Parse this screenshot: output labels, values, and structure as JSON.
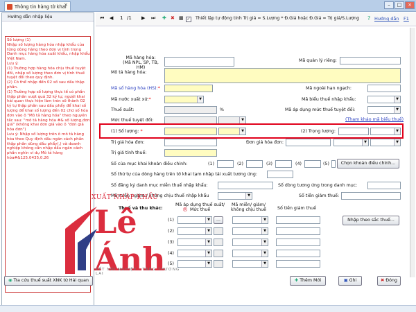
{
  "window": {
    "tab_title": "Thông tin hàng tờ khai",
    "close": "×"
  },
  "left_panel": {
    "header": "Hướng dẫn nhập liệu",
    "text": "Số lượng (1)\nNhập số lượng hàng hóa nhập khẩu của từng dòng hàng theo đơn vị tính trong Danh mục hàng hóa xuất khẩu, nhập khẩu Việt Nam.\nLưu ý:\n(1) Trường hợp hàng hóa chịu thuế tuyệt đối, nhập số lượng theo đơn vị tính thuế tuyệt đối theo quy định.\n(2) Có thể nhập đến 02 số sau dấu thập phân.\n(1) Trường hợp số lượng thực tế có phần thập phân vượt quá 32 ký tự, người khai hải quan thực hiện làm tròn số thành 02 ký tự thập phân sau dấu phẩy để khai số lượng để khai số lượng đến 02 chữ số hóa đơn vào ô \"Mô tả hàng hóa\" theo nguyên tắc sau: \"mô tả hàng hóa #& số lượng,đơn giá\" (không khai đơn giá vào ô \"đơn giá hóa đơn\")\nLưu ý: Nhập số lượng trên ô mô tả hàng hóa theo Quy định dấu ngăn cách phần thập phân dùng dấu phẩy(,) và doanh nghiệp không cần nhập dấu ngăn cách phần nghìn ví dụ Mô tả hàng hóa#&125.0435,0.26"
  },
  "toolbar": {
    "page_current": "1",
    "page_sep": "/1",
    "auto_calc_label": "Thiết lập tự động tính Trị giá = S.Lượng * Đ.Giá hoặc Đ.Giá = Trị giá/S.Lượng",
    "help_label": "Hướng dẫn",
    "help_key": "F1"
  },
  "form": {
    "ma_hang_hoa": "Mã hàng hóa:\n(Mã NPL, SP, TB, HM)",
    "ma_quan_ly_rieng": "Mã quản lý riêng:",
    "mo_ta_hang_hoa": "Mô tả hàng hóa:",
    "ma_so_hang_hoa": "Mã số hàng hóa (HS):",
    "ma_ngoai_han_ngach": "Mã ngoài hạn ngạch:",
    "ma_nuoc_xuat_xu": "Mã nước xuất xứ:",
    "ma_bieu_thue_nk": "Mã biểu thuế nhập khẩu:",
    "thue_suat": "Thuế suất:",
    "percent": "%",
    "ma_ap_dung_muc_thue": "Mã áp dụng mức thuế tuyệt đối:",
    "muc_thue_tuyet_doi": "Mức thuế tuyệt đối:",
    "tham_khao": "(Tham khảo mã biểu thuế)",
    "so_luong_1": "(1) Số lượng:",
    "so_luong_2": "(2) Trọng lượng:",
    "tri_gia_hoa_don": "Trị giá hóa đơn:",
    "don_gia_hoa_don": "Đơn giá hóa đơn:",
    "tri_gia_tinh_thue": "Trị giá tính thuế:",
    "so_cua_muc_khai": "Số của mục khai khoản điều chỉnh:",
    "dc_labels": [
      "(1)",
      "(2)",
      "(3)",
      "(4)",
      "(5)"
    ],
    "chon_khoan_dieu_chinh": "Chọn khoản điều chỉnh...",
    "so_thu_tu_dong_hang": "Số thứ tự của dòng hàng trên tờ khai tạm nhập tái xuất tương ứng:",
    "so_dang_ky_danh_muc": "Số đăng ký danh mục miễn thuế nhập khẩu:",
    "so_dong_tuong_ung": "Số dòng tương ứng trong danh mục:",
    "ma_mien_giam": "Mã miễn / giảm / không chịu thuế nhập khẩu",
    "so_tien_giam_thue": "Số tiền giảm thuế:",
    "thue_thu_khac": "Thuế và thu khác:",
    "col_ap_dung": "Mã áp dụng thuế suất/\nMức thuế",
    "col_mien_giam": "Mã miễn/ giảm/\nkhông chịu thuế",
    "col_so_tien": "Số tiền giảm thuế",
    "rows": [
      "(1)",
      "(2)",
      "(3)",
      "(4)",
      "(5)"
    ],
    "nhap_theo_sac_thue": "Nhập theo sắc thuế...",
    "dots": "..."
  },
  "watermark": {
    "line1": "XUẤT NHẬP KHẨU",
    "line2": "Lê Ánh",
    "reg": "®",
    "slogan": "KẾT NỐI NGHIỆP - TĂNG THƯƠNG LAI"
  },
  "bottom": {
    "tra_cuu": "Tra cứu thuế suất XNK từ Hải quan",
    "them_moi": "Thêm Mới",
    "ghi": "Ghi",
    "dong": "Đóng"
  },
  "colors": {
    "highlight_border": "#e0001a",
    "required_field": "#fffcc0",
    "link": "#2a3fc0"
  }
}
